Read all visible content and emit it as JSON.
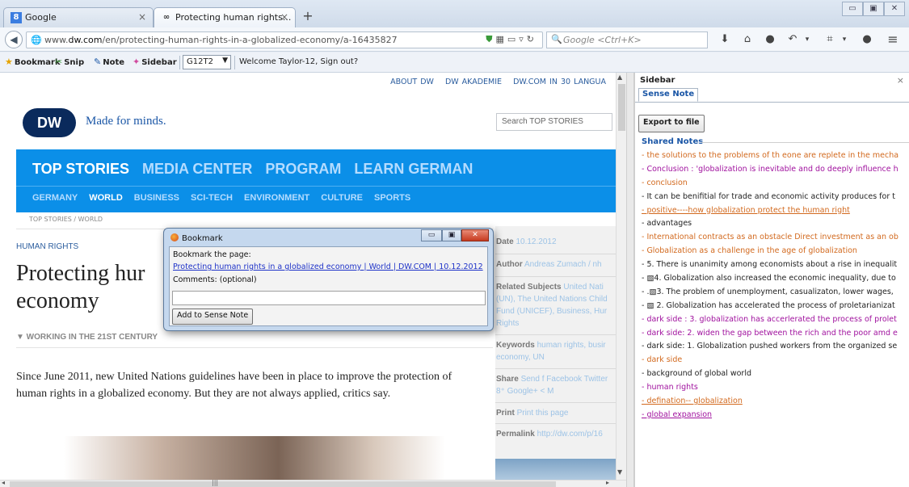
{
  "browser": {
    "tabs": [
      {
        "label": "Google",
        "icon": "google-icon"
      },
      {
        "label": "Protecting human rights...",
        "icon": "sense-note-icon"
      }
    ],
    "url_prefix": "www.",
    "url_domain": "dw.com",
    "url_path": "/en/protecting-human-rights-in-a-globalized-economy/a-16435827",
    "search_placeholder": "Google <Ctrl+K>"
  },
  "bookmarks_toolbar": {
    "bookmark_label": "Bookmark",
    "snip_label": "Snip",
    "note_label": "Note",
    "sidebar_label": "Sidebar",
    "group_select": "G12T2",
    "welcome": "Welcome Taylor-12, Sign out?"
  },
  "page": {
    "top_nav": [
      "ABOUT DW",
      "DW AKADEMIE",
      "DW.COM IN 30 LANGUA"
    ],
    "logo": "DW",
    "tagline": "Made for minds.",
    "search_placeholder": "Search TOP STORIES",
    "main_nav": [
      "TOP STORIES",
      "MEDIA CENTER",
      "PROGRAM",
      "LEARN GERMAN"
    ],
    "sub_nav": [
      "GERMANY",
      "WORLD",
      "BUSINESS",
      "SCI-TECH",
      "ENVIRONMENT",
      "CULTURE",
      "SPORTS"
    ],
    "breadcrumb": "TOP STORIES / WORLD",
    "kicker": "HUMAN RIGHTS",
    "headline_line1": "Protecting hur",
    "headline_line2": "economy",
    "section": "▼  WORKING IN THE 21ST CENTURY",
    "teaser": "Since June 2011, new United Nations guidelines have been in place to improve the protection of human rights in a globalized economy. But they are not always applied, critics say.",
    "info": {
      "date_label": "Date",
      "date_value": "10.12.2012",
      "author_label": "Author",
      "author_value": "Andreas Zumach / nh",
      "related_label": "Related Subjects",
      "related_value": "United Nati (UN), The United Nations Child Fund (UNICEF), Business, Hur Rights",
      "keywords_label": "Keywords",
      "keywords_value": "human rights, busir economy, UN",
      "share_label": "Share",
      "share_value": "Send  f Facebook  Twitter  8⁺ Google+  < M",
      "print_label": "Print",
      "print_value": "Print this page",
      "permalink_label": "Permalink",
      "permalink_value": "http://dw.com/p/16"
    }
  },
  "dialog": {
    "title": "Bookmark",
    "bookmark_label": "Bookmark the page:",
    "page_link": "Protecting human rights in a globalized economy | World | DW.COM | 10.12.2012",
    "comments_label": "Comments: (optional)",
    "comments_value": "",
    "add_button": "Add to Sense Note"
  },
  "sidebar": {
    "title": "Sidebar",
    "tab": "Sense Note",
    "export_button": "Export to file",
    "shared_notes_label": "Shared Notes",
    "notes": [
      {
        "text": "- the solutions to the problems of th eone are replete in the mecha",
        "color": "#d2691e",
        "underline": false
      },
      {
        "text": "- Conclusion : 'globalization is inevitable and  do deeply influence h",
        "color": "#a0129e",
        "underline": false
      },
      {
        "text": "- conclusion",
        "color": "#d2691e",
        "underline": false
      },
      {
        "text": "- It can be benifitial for trade and economic activity produces for t",
        "color": "#222222",
        "underline": false
      },
      {
        "text": "- positive----how globalization protect the human right",
        "color": "#d2691e",
        "underline": true
      },
      {
        "text": "- advantages",
        "color": "#222222",
        "underline": false
      },
      {
        "text": "- International contracts as an obstacle Direct investment as an ob",
        "color": "#d2691e",
        "underline": false
      },
      {
        "text": "- Globalization as a challenge in the age of globalization",
        "color": "#d2691e",
        "underline": false
      },
      {
        "text": "- 5. There is unanimity among economists about a rise in inequalit",
        "color": "#222222",
        "underline": false
      },
      {
        "text": "- ▧4. Globalization also increased the economic inequality, due to",
        "color": "#222222",
        "underline": false
      },
      {
        "text": "- .▧3. The problem of unemployment, casualizaton, lower wages, ",
        "color": "#222222",
        "underline": false
      },
      {
        "text": "- ▧ 2. Globalization has accelerated the process of proletarianizat",
        "color": "#222222",
        "underline": false
      },
      {
        "text": "- dark side : 3. globalization has accerlerated the process of prolet",
        "color": "#a0129e",
        "underline": false
      },
      {
        "text": "- dark side: 2. widen the gap between the rich and the poor amd e",
        "color": "#a0129e",
        "underline": false
      },
      {
        "text": "- dark side: 1. Globalization pushed workers from the organized se",
        "color": "#222222",
        "underline": false
      },
      {
        "text": "- dark side",
        "color": "#d2691e",
        "underline": false
      },
      {
        "text": "- background of global world",
        "color": "#222222",
        "underline": false
      },
      {
        "text": "- human rights",
        "color": "#a0129e",
        "underline": false
      },
      {
        "text": "- defination-- globalization",
        "color": "#d2691e",
        "underline": true
      },
      {
        "text": "- global expansion",
        "color": "#a0129e",
        "underline": true
      }
    ]
  }
}
